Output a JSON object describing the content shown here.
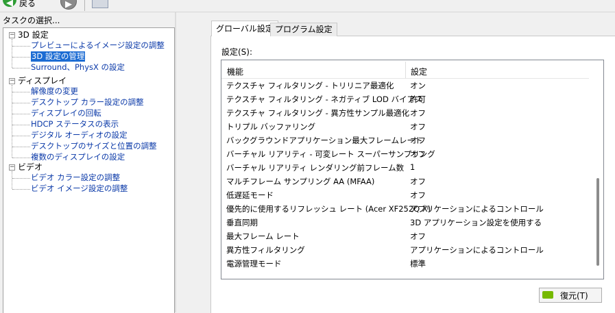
{
  "toolbar": {
    "back_label": "戻る"
  },
  "left_panel": {
    "title": "タスクの選択...",
    "tree": [
      {
        "label": "3D 設定",
        "expander": "⊟",
        "children": [
          {
            "label": "プレビューによるイメージ設定の調整",
            "selected": false
          },
          {
            "label": "3D 設定の管理",
            "selected": true
          },
          {
            "label": "Surround、PhysX の設定",
            "selected": false
          }
        ]
      },
      {
        "label": "ディスプレイ",
        "expander": "⊟",
        "children": [
          {
            "label": "解像度の変更",
            "selected": false
          },
          {
            "label": "デスクトップ カラー設定の調整",
            "selected": false
          },
          {
            "label": "ディスプレイの回転",
            "selected": false
          },
          {
            "label": "HDCP ステータスの表示",
            "selected": false
          },
          {
            "label": "デジタル オーディオの設定",
            "selected": false
          },
          {
            "label": "デスクトップのサイズと位置の調整",
            "selected": false
          },
          {
            "label": "複数のディスプレイの設定",
            "selected": false
          }
        ]
      },
      {
        "label": "ビデオ",
        "expander": "⊟",
        "children": [
          {
            "label": "ビデオ カラー設定の調整",
            "selected": false
          },
          {
            "label": "ビデオ イメージ設定の調整",
            "selected": false
          }
        ]
      }
    ]
  },
  "tabs": [
    {
      "label": "グローバル設定",
      "active": true
    },
    {
      "label": "プログラム設定",
      "active": false
    }
  ],
  "settings": {
    "label": "設定(S):",
    "columns": {
      "feature": "機能",
      "setting": "設定"
    },
    "rows": [
      {
        "feature": "テクスチャ フィルタリング - トリリニア最適化",
        "setting": "オン"
      },
      {
        "feature": "テクスチャ フィルタリング - ネガティブ LOD バイアス",
        "setting": "許可"
      },
      {
        "feature": "テクスチャ フィルタリング - 異方性サンプル最適化",
        "setting": "オフ"
      },
      {
        "feature": "トリプル バッファリング",
        "setting": "オフ"
      },
      {
        "feature": "バックグラウンドアプリケーション最大フレームレート",
        "setting": "オフ"
      },
      {
        "feature": "バーチャル リアリティ - 可変レート スーパーサンプリング",
        "setting": "オフ"
      },
      {
        "feature": "バーチャル リアリティ レンダリング前フレーム数",
        "setting": "1"
      },
      {
        "feature": "マルチフレーム サンプリング AA (MFAA)",
        "setting": "オフ"
      },
      {
        "feature": "低遅延モード",
        "setting": "オフ"
      },
      {
        "feature": "優先的に使用するリフレッシュ レート (Acer XF252Q X)",
        "setting": "アプリケーションによるコントロール"
      },
      {
        "feature": "垂直同期",
        "setting": "3D アプリケーション設定を使用する"
      },
      {
        "feature": "最大フレーム レート",
        "setting": "オフ"
      },
      {
        "feature": "異方性フィルタリング",
        "setting": "アプリケーションによるコントロール"
      },
      {
        "feature": "電源管理モード",
        "setting": "標準"
      }
    ]
  },
  "restore_button": {
    "label": "復元(T)"
  },
  "colors": {
    "selection": "#1c6cd3",
    "link": "#0a39a8",
    "nvidia_green": "#76b900"
  }
}
